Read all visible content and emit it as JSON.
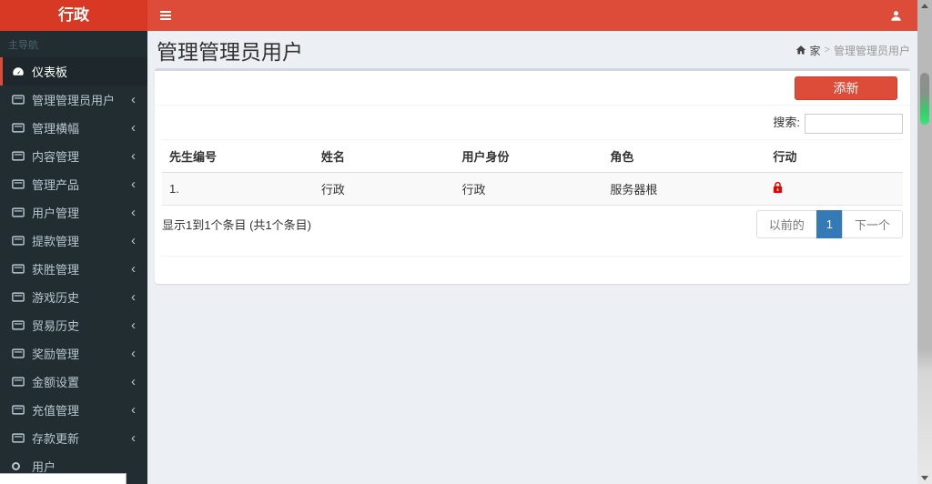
{
  "header": {
    "logo_text": "行政"
  },
  "sidebar": {
    "section_label": "主导航",
    "items": [
      {
        "label": "仪表板",
        "icon": "dashboard-icon",
        "active": true,
        "has_children": false
      },
      {
        "label": "管理管理员用户",
        "icon": "panel-icon",
        "active": false,
        "has_children": true
      },
      {
        "label": "管理横幅",
        "icon": "panel-icon",
        "active": false,
        "has_children": true
      },
      {
        "label": "内容管理",
        "icon": "panel-icon",
        "active": false,
        "has_children": true
      },
      {
        "label": "管理产品",
        "icon": "panel-icon",
        "active": false,
        "has_children": true
      },
      {
        "label": "用户管理",
        "icon": "panel-icon",
        "active": false,
        "has_children": true
      },
      {
        "label": "提款管理",
        "icon": "panel-icon",
        "active": false,
        "has_children": true
      },
      {
        "label": "获胜管理",
        "icon": "panel-icon",
        "active": false,
        "has_children": true
      },
      {
        "label": "游戏历史",
        "icon": "panel-icon",
        "active": false,
        "has_children": true
      },
      {
        "label": "贸易历史",
        "icon": "panel-icon",
        "active": false,
        "has_children": true
      },
      {
        "label": "奖励管理",
        "icon": "panel-icon",
        "active": false,
        "has_children": true
      },
      {
        "label": "金额设置",
        "icon": "panel-icon",
        "active": false,
        "has_children": true
      },
      {
        "label": "充值管理",
        "icon": "panel-icon",
        "active": false,
        "has_children": true
      },
      {
        "label": "存款更新",
        "icon": "panel-icon",
        "active": false,
        "has_children": true
      },
      {
        "label": "用户",
        "icon": "circle-o-icon",
        "active": false,
        "has_children": false
      }
    ]
  },
  "content": {
    "page_title": "管理管理员用户",
    "breadcrumb": {
      "home": "家",
      "separator": ">",
      "current": "管理管理员用户"
    },
    "add_button": "添新",
    "search_label": "搜索:",
    "search_value": "",
    "table": {
      "columns": [
        "先生编号",
        "姓名",
        "用户身份",
        "角色",
        "行动"
      ],
      "rows": [
        {
          "sn": "1.",
          "name": "行政",
          "user_identity": "行政",
          "role": "服务器根",
          "action_icon": "lock-icon"
        }
      ]
    },
    "info_text": "显示1到1个条目 (共1个条目)",
    "pagination": {
      "previous": "以前的",
      "pages": [
        "1"
      ],
      "active_page": "1",
      "next": "下一个"
    }
  },
  "icons": {
    "chevron_left": "‹"
  },
  "colors": {
    "navbar": "#dd4b39",
    "logo_bg": "#d73925",
    "sidebar_bg": "#222d32",
    "sidebar_text": "#b8c7ce",
    "content_bg": "#ecf0f5",
    "active_page_bg": "#337ab7",
    "lock_red": "#ee0000",
    "scrollbar_green": "#35e573"
  }
}
